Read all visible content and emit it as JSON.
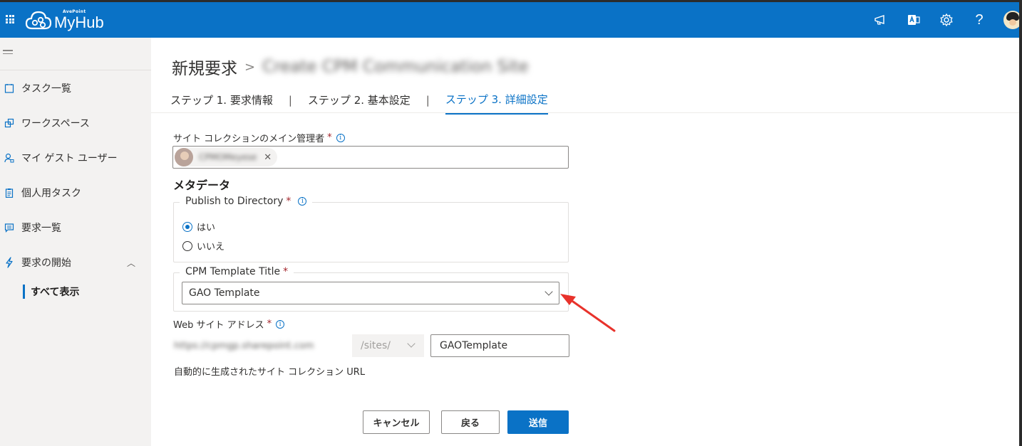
{
  "app": {
    "logo_small": "AvePoint",
    "logo_text": "MyHub"
  },
  "topbar": {
    "icons": [
      "megaphone-icon",
      "office-app-icon",
      "gear-icon",
      "help-icon",
      "avatar"
    ]
  },
  "sidebar": {
    "items": [
      {
        "label": "タスク一覧",
        "icon": "task-list-icon"
      },
      {
        "label": "ワークスペース",
        "icon": "workspace-icon"
      },
      {
        "label": "マイ ゲスト ユーザー",
        "icon": "guest-user-icon"
      },
      {
        "label": "個人用タスク",
        "icon": "clipboard-icon"
      },
      {
        "label": "要求一覧",
        "icon": "chat-list-icon"
      },
      {
        "label": "要求の開始",
        "icon": "lightning-icon",
        "expanded": true
      }
    ],
    "sub_item": "すべて表示"
  },
  "header": {
    "breadcrumb_root": "新規要求",
    "breadcrumb_sep": ">",
    "breadcrumb_current": "Create CPM Communication Site"
  },
  "steps": [
    {
      "label": "ステップ 1. 要求情報",
      "active": false
    },
    {
      "label": "ステップ 2. 基本設定",
      "active": false
    },
    {
      "label": "ステップ 3. 詳細設定",
      "active": true
    }
  ],
  "step_separator": "|",
  "form": {
    "owner_label": "サイト コレクションのメイン管理者",
    "required_mark": "*",
    "owner_value": "CPMOMeyese",
    "metadata_title": "メタデータ",
    "publish_label": "Publish to Directory",
    "publish_options": [
      "はい",
      "いいえ"
    ],
    "publish_selected": "はい",
    "template_label": "CPM Template Title",
    "template_value": "GAO Template",
    "url_label": "Web サイト アドレス",
    "url_prefix": "https://cpmgp.sharepoint.com",
    "url_path": "/sites/",
    "url_value": "GAOTemplate",
    "url_hint": "自動的に生成されたサイト コレクション URL"
  },
  "buttons": {
    "cancel": "キャンセル",
    "back": "戻る",
    "submit": "送信"
  },
  "colors": {
    "brand": "#0a72c6",
    "annotation_arrow": "#e8322b",
    "required": "#a4262c"
  }
}
